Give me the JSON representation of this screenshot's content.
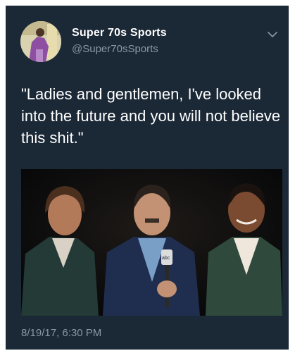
{
  "user": {
    "display_name": "Super 70s Sports",
    "handle": "@Super70sSports"
  },
  "tweet": {
    "text": "\"Ladies and gentlemen, I've looked into the future and you will not believe this shit.\"",
    "timestamp": "8/19/17, 6:30 PM"
  },
  "icons": {
    "menu": "chevron-down-icon"
  },
  "colors": {
    "background": "#1b2836",
    "primary_text": "#ffffff",
    "secondary_text": "#8899a6"
  }
}
